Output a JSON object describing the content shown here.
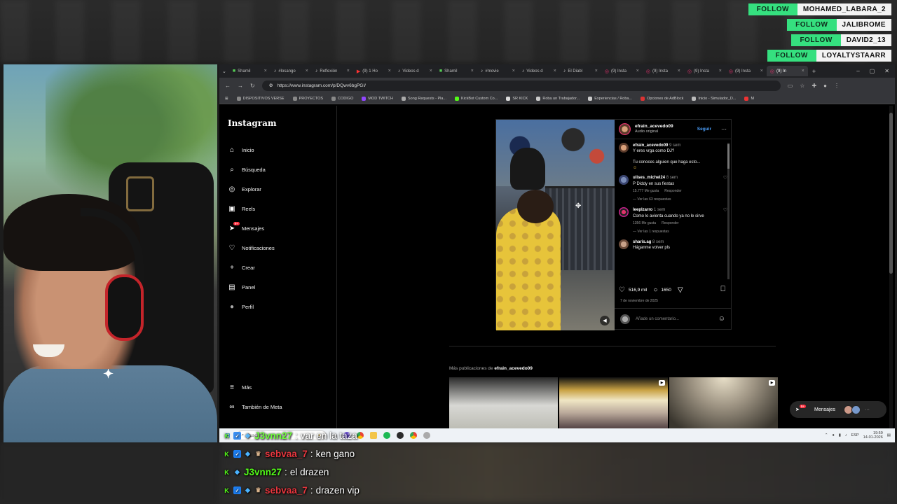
{
  "follows": [
    {
      "tag": "FOLLOW",
      "name": "MOHAMED_LABARA_2"
    },
    {
      "tag": "FOLLOW",
      "name": "JALIBROME"
    },
    {
      "tag": "FOLLOW",
      "name": "DAVID2_13"
    },
    {
      "tag": "FOLLOW",
      "name": "LOYALTYSTAARR"
    }
  ],
  "browser": {
    "tabs": [
      "Shamil",
      "#losango",
      "Reflexión",
      "(9) 1 Ho",
      "Videos d",
      "Shamil",
      "#movie",
      "Videos d",
      "El Diabl",
      "(9) Insta",
      "(9) Insta",
      "(9) Insta",
      "(9) Insta",
      "(9) In"
    ],
    "new_tab": "+",
    "window_controls": {
      "minimize": "–",
      "maximize": "▢",
      "close": "✕"
    },
    "url": "https://www.instagram.com/p/DQwv6bgPGI/",
    "bookmarks": [
      "DISPOSITIVOS VERSE",
      "PROYECTOS",
      "CODIGO",
      "MOD TWITCH",
      "Song Requests - Pla...",
      "KickBot Custom Co...",
      "SR KICK",
      "Roba un Trabajador...",
      "Experiencias / Roba...",
      "Opciones de AdBlock",
      "Inicio - Simulador_D...",
      "M"
    ]
  },
  "instagram": {
    "logo": "Instagram",
    "nav": [
      {
        "label": "Inicio",
        "icon": "home-icon",
        "glyph": "⌂"
      },
      {
        "label": "Búsqueda",
        "icon": "search-icon",
        "glyph": "⌕"
      },
      {
        "label": "Explorar",
        "icon": "compass-icon",
        "glyph": "◎"
      },
      {
        "label": "Reels",
        "icon": "reels-icon",
        "glyph": "▣"
      },
      {
        "label": "Mensajes",
        "icon": "messages-icon",
        "glyph": "➤",
        "badge": "9+"
      },
      {
        "label": "Notificaciones",
        "icon": "heart-icon",
        "glyph": "♡"
      },
      {
        "label": "Crear",
        "icon": "plus-icon",
        "glyph": "+"
      },
      {
        "label": "Panel",
        "icon": "dashboard-icon",
        "glyph": "▤"
      },
      {
        "label": "Perfil",
        "icon": "profile-avatar-icon",
        "glyph": "●"
      }
    ],
    "nav_bottom": [
      {
        "label": "Más",
        "icon": "menu-icon",
        "glyph": "≡"
      },
      {
        "label": "También de Meta",
        "icon": "meta-icon",
        "glyph": "∞"
      }
    ],
    "post": {
      "username": "efrain_acevedo09",
      "audio": "Audio original",
      "follow": "Seguir",
      "more": "···",
      "comments": [
        {
          "user": "efrain_acevedo09",
          "time": "9 sem",
          "text": "Y eres vrga como DJ?",
          "extra": "Tu conoces alguien que haga esto..."
        },
        {
          "user": "ulises_michel24",
          "time": "8 sem",
          "text": "P Diddy en sus fiestas",
          "likes": "15.777 Me gusta",
          "reply": "Responder",
          "replies": "Ver las 63 respuestas"
        },
        {
          "user": "leeplzarro",
          "time": "1 sem",
          "text": "Como lo avienta cuando ya no le sirve",
          "likes": "1356 Me gusta",
          "reply": "Responder",
          "replies": "Ver las 1 respuestas"
        },
        {
          "user": "sharis.ag",
          "time": "8 sem",
          "text": "Háganme volver pls"
        }
      ],
      "like_count": "516,9 mil",
      "comment_count": "1650",
      "date": "7 de noviembre de 2025",
      "add_comment": "Añade un comentario..."
    },
    "more_from_prefix": "Más publicaciones de",
    "more_from_user": "efrain_acevedo09",
    "messages_pill": {
      "label": "Mensajes",
      "badge": "9+"
    }
  },
  "taskbar": {
    "search": "Buscar",
    "lang": "ESP",
    "time": "19:59",
    "date": "14-01-2026"
  },
  "chat": [
    {
      "user": "J3vnn27",
      "sep": ":",
      "text": "var en la taza",
      "color": "green",
      "badges": [
        "k",
        "v",
        "g"
      ]
    },
    {
      "user": "sebvaa_7",
      "sep": ":",
      "text": "ken gano",
      "color": "red",
      "badges": [
        "k",
        "v",
        "g",
        "c"
      ]
    },
    {
      "user": "J3vnn27",
      "sep": ":",
      "text": "el drazen",
      "color": "green",
      "badges": [
        "k",
        "g"
      ]
    },
    {
      "user": "sebvaa_7",
      "sep": ":",
      "text": "drazen vip",
      "color": "red",
      "badges": [
        "k",
        "v",
        "g",
        "c"
      ]
    }
  ]
}
